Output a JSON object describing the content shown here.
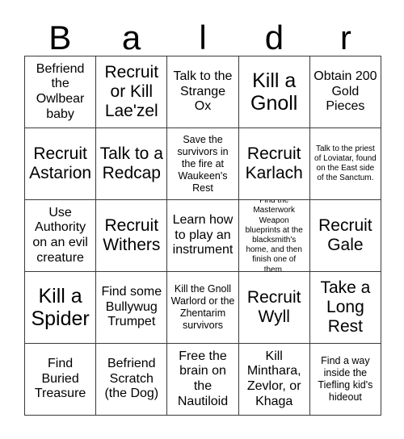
{
  "card": {
    "title_letters": [
      "B",
      "a",
      "l",
      "d",
      "r"
    ],
    "columns": 5,
    "rows": 5,
    "border_color": "#3a3a3a",
    "background_color": "#ffffff",
    "text_color": "#000000",
    "cells": [
      {
        "text": "Befriend the Owlbear baby",
        "size": "md"
      },
      {
        "text": "Recruit or Kill Lae'zel",
        "size": "lg"
      },
      {
        "text": "Talk to the Strange Ox",
        "size": "md"
      },
      {
        "text": "Kill a Gnoll",
        "size": "xl"
      },
      {
        "text": "Obtain 200 Gold Pieces",
        "size": "md"
      },
      {
        "text": "Recruit Astarion",
        "size": "lg"
      },
      {
        "text": "Talk to a Redcap",
        "size": "lg"
      },
      {
        "text": "Save the survivors in the fire at Waukeen's Rest",
        "size": "sm"
      },
      {
        "text": "Recruit Karlach",
        "size": "lg"
      },
      {
        "text": "Talk to the priest of Loviatar, found on the East side of the Sanctum.",
        "size": "xs"
      },
      {
        "text": "Use Authority on an evil creature",
        "size": "md"
      },
      {
        "text": "Recruit Withers",
        "size": "lg"
      },
      {
        "text": "Learn how to play an instrument",
        "size": "md"
      },
      {
        "text": "Find the Masterwork Weapon blueprints at the blacksmith's home, and then finish one of them.",
        "size": "xs"
      },
      {
        "text": "Recruit Gale",
        "size": "lg"
      },
      {
        "text": "Kill a Spider",
        "size": "xl"
      },
      {
        "text": "Find some Bullywug Trumpet",
        "size": "md"
      },
      {
        "text": "Kill the Gnoll Warlord or the Zhentarim survivors",
        "size": "sm"
      },
      {
        "text": "Recruit Wyll",
        "size": "lg"
      },
      {
        "text": "Take a Long Rest",
        "size": "lg"
      },
      {
        "text": "Find Buried Treasure",
        "size": "md"
      },
      {
        "text": "Befriend Scratch (the Dog)",
        "size": "md"
      },
      {
        "text": "Free the brain on the Nautiloid",
        "size": "md"
      },
      {
        "text": "Kill Minthara, Zevlor, or Khaga",
        "size": "md"
      },
      {
        "text": "Find a way inside the Tiefling kid's hideout",
        "size": "sm"
      }
    ]
  }
}
